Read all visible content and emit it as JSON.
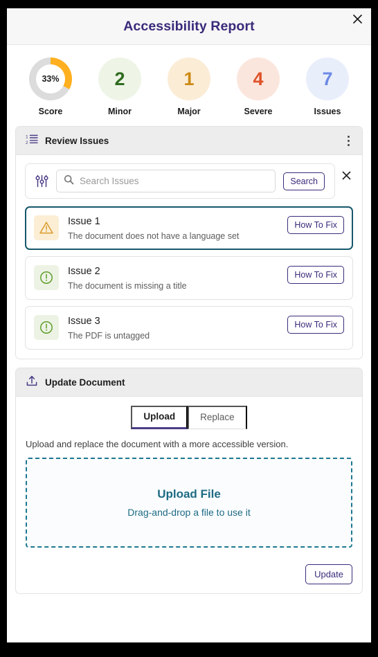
{
  "header": {
    "title": "Accessibility Report",
    "close_icon": "close-icon"
  },
  "stats": [
    {
      "key": "score",
      "value": "33%",
      "label": "Score",
      "type": "donut",
      "percent": 33,
      "ring_color": "#ffb020",
      "track_color": "#dcdcdc",
      "value_color": "#1c1c1c"
    },
    {
      "key": "minor",
      "value": "2",
      "label": "Minor",
      "type": "circle",
      "bg": "#eef5e7",
      "value_color": "#2f6b1f"
    },
    {
      "key": "major",
      "value": "1",
      "label": "Major",
      "type": "circle",
      "bg": "#fbecd6",
      "value_color": "#cc8a16"
    },
    {
      "key": "severe",
      "value": "4",
      "label": "Severe",
      "type": "circle",
      "bg": "#fbe6dd",
      "value_color": "#e0522a"
    },
    {
      "key": "issues",
      "value": "7",
      "label": "Issues",
      "type": "circle",
      "bg": "#e9eefb",
      "value_color": "#6c8ae4"
    }
  ],
  "review": {
    "title": "Review Issues",
    "list_icon": "numbered-list-icon",
    "menu_icon": "kebab-menu-icon",
    "search": {
      "filter_icon": "filter-sliders-icon",
      "search_icon": "search-icon",
      "placeholder": "Search Issues",
      "value": "",
      "button_label": "Search",
      "close_icon": "close-icon"
    },
    "issues": [
      {
        "title": "Issue 1",
        "description": "The document does not have a language set",
        "action_label": "How To Fix",
        "severity_icon": "warning-triangle-icon",
        "selected": true
      },
      {
        "title": "Issue 2",
        "description": "The document is missing a title",
        "action_label": "How To Fix",
        "severity_icon": "info-circle-icon",
        "selected": false
      },
      {
        "title": "Issue 3",
        "description": "The PDF is untagged",
        "action_label": "How To Fix",
        "severity_icon": "info-circle-icon",
        "selected": false
      }
    ]
  },
  "update": {
    "title": "Update Document",
    "upload_icon": "upload-tray-icon",
    "tabs": [
      {
        "label": "Upload",
        "active": true
      },
      {
        "label": "Replace",
        "active": false
      }
    ],
    "description": "Upload and replace the document with a more accessible version.",
    "dropzone": {
      "title": "Upload File",
      "subtitle": "Drag-and-drop a file to use it"
    },
    "update_button_label": "Update"
  },
  "colors": {
    "brand_purple": "#3a2a7a",
    "tab_accent": "#4a3b86",
    "selected_border": "#16576b",
    "dropzone_teal": "#1d7791",
    "score_ring": "#ffb020"
  }
}
